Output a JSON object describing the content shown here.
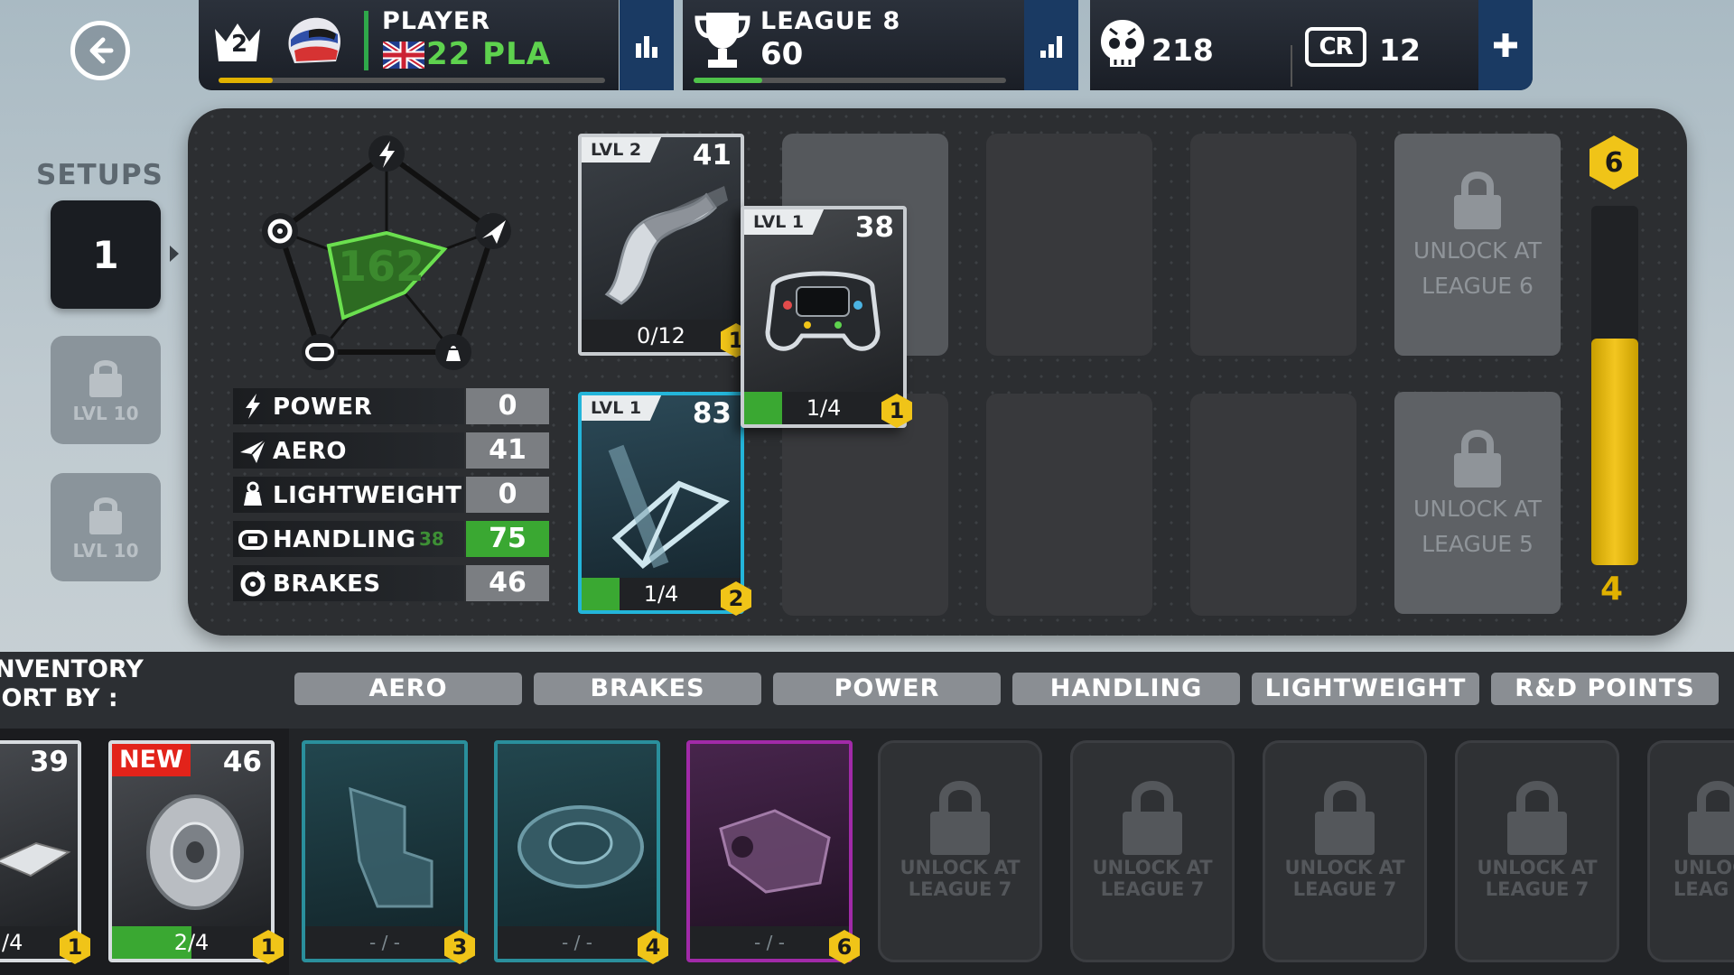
{
  "topbar": {
    "player": {
      "rank": "2",
      "label": "PLAYER",
      "name": "22 PLA",
      "xp_progress": 0.14
    },
    "league": {
      "label": "LEAGUE 8",
      "points": "60",
      "progress": 0.22
    },
    "currency": {
      "research_points": "218",
      "credits_badge": "CR",
      "credits": "12"
    }
  },
  "setups": {
    "title": "SETUPS",
    "active": "1",
    "locked": [
      {
        "label": "LVL 10"
      },
      {
        "label": "LVL 10"
      }
    ]
  },
  "radar": {
    "total": "162"
  },
  "stats": [
    {
      "icon": "lightning-icon",
      "label": "POWER",
      "value": "0"
    },
    {
      "icon": "paper-plane-icon",
      "label": "AERO",
      "value": "41"
    },
    {
      "icon": "weight-icon",
      "label": "LIGHTWEIGHT",
      "value": "0"
    },
    {
      "icon": "steering-wheel-icon",
      "label": "HANDLING",
      "value": "75",
      "previous": "38"
    },
    {
      "icon": "brake-disc-icon",
      "label": "BRAKES",
      "value": "46"
    }
  ],
  "equipped": {
    "front_wing": {
      "level": "LVL 2",
      "rating": "41",
      "progress": "0/12",
      "badge": "1"
    },
    "steering": {
      "level": "LVL 1",
      "rating": "38",
      "progress": "1/4",
      "badge": "1"
    },
    "suspension": {
      "level": "LVL 1",
      "rating": "83",
      "progress": "1/4",
      "badge": "2"
    }
  },
  "locked_slots": [
    {
      "line1": "UNLOCK AT",
      "line2": "LEAGUE 6"
    },
    {
      "line1": "UNLOCK AT",
      "line2": "LEAGUE 5"
    }
  ],
  "meter": {
    "top": "6",
    "bottom": "4",
    "fill": 0.63
  },
  "inventory": {
    "title": "INVENTORY",
    "sort_by": "SORT BY :",
    "filters": [
      "AERO",
      "BRAKES",
      "POWER",
      "HANDLING",
      "LIGHTWEIGHT",
      "R&D POINTS"
    ],
    "cards": [
      {
        "rating": "39",
        "progress": "/4",
        "badge": "1"
      },
      {
        "tag": "NEW",
        "rating": "46",
        "progress": "2/4",
        "badge": "1"
      },
      {
        "progress": "- / -",
        "badge": "3"
      },
      {
        "progress": "- / -",
        "badge": "4"
      },
      {
        "progress": "- / -",
        "badge": "6"
      }
    ],
    "locked": [
      {
        "line1": "UNLOCK AT",
        "line2": "LEAGUE 7"
      },
      {
        "line1": "UNLOCK AT",
        "line2": "LEAGUE 7"
      },
      {
        "line1": "UNLOCK AT",
        "line2": "LEAGUE 7"
      },
      {
        "line1": "UNLOCK AT",
        "line2": "LEAGUE 7"
      },
      {
        "line1": "UNLOC",
        "line2": "LEAG"
      }
    ]
  },
  "colors": {
    "accent_green": "#5ed24e",
    "badge_yellow": "#f0c418",
    "button_blue": "#1a3a63"
  }
}
